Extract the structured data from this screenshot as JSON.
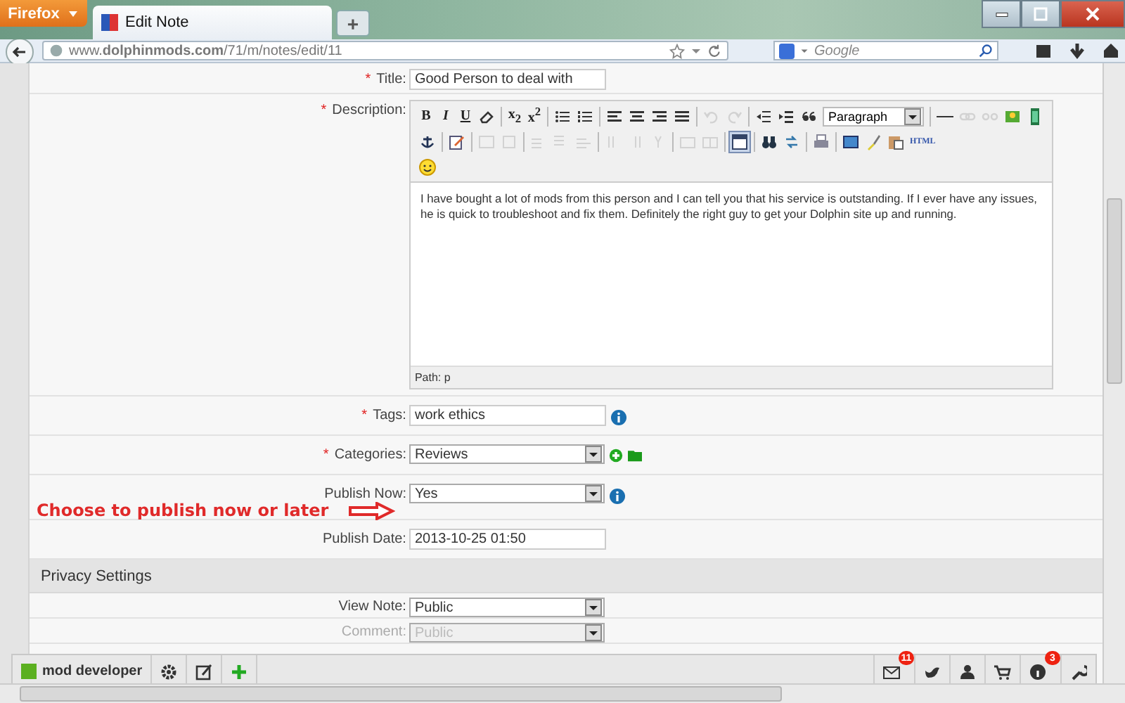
{
  "browser": {
    "menu_button": "Firefox",
    "tabs": [
      {
        "title": "Edit Note",
        "selected": true
      }
    ],
    "new_tab": "+",
    "url": "www.**dolphinmods.com**/71/m/notes/edit/11",
    "search": {
      "placeholder": "Google"
    }
  },
  "form": {
    "title": {
      "label": "Title:",
      "marker": "*",
      "value": "Good Person to deal with"
    },
    "description": {
      "label": "Description:",
      "marker": "*",
      "toolbar_rows": [
        [
          {
            "kind": "text",
            "label": "B"
          },
          {
            "kind": "text",
            "label": "I"
          },
          {
            "kind": "text",
            "label": "U"
          },
          {
            "kind": "icon",
            "disabled": false
          },
          {
            "kind": "sep"
          },
          {
            "kind": "text",
            "label": "x$_{2}$"
          },
          {
            "kind": "text",
            "label": "x$^{2}$"
          },
          {
            "kind": "sep"
          },
          {
            "kind": "icon",
            "disabled": false
          },
          {
            "kind": "icon",
            "disabled": false
          },
          {
            "kind": "sep"
          },
          {
            "kind": "icon",
            "disabled": false
          },
          {
            "kind": "icon",
            "disabled": false
          },
          {
            "kind": "icon",
            "disabled": false
          },
          {
            "kind": "icon",
            "disabled": false
          },
          {
            "kind": "sep"
          },
          {
            "kind": "icon",
            "disabled": true
          },
          {
            "kind": "icon",
            "disabled": true
          },
          {
            "kind": "sep"
          },
          {
            "kind": "icon",
            "disabled": false
          },
          {
            "kind": "icon",
            "disabled": false
          },
          {
            "kind": "icon",
            "disabled": false
          },
          {
            "kind": "select",
            "label": "Paragraph"
          },
          {
            "kind": "sep"
          },
          {
            "kind": "icon",
            "disabled": false
          },
          {
            "kind": "icon",
            "disabled": true
          },
          {
            "kind": "icon",
            "disabled": true
          },
          {
            "kind": "icon",
            "disabled": false
          },
          {
            "kind": "icon",
            "disabled": false
          }
        ],
        [
          {
            "kind": "icon",
            "disabled": false
          },
          {
            "kind": "sep"
          },
          {
            "kind": "icon",
            "disabled": false
          },
          {
            "kind": "sep"
          },
          {
            "kind": "icon",
            "disabled": true
          },
          {
            "kind": "icon",
            "disabled": true
          },
          {
            "kind": "sep"
          },
          {
            "kind": "icon",
            "disabled": true
          },
          {
            "kind": "icon",
            "disabled": true
          },
          {
            "kind": "icon",
            "disabled": true
          },
          {
            "kind": "sep"
          },
          {
            "kind": "icon",
            "disabled": true
          },
          {
            "kind": "icon",
            "disabled": true
          },
          {
            "kind": "icon",
            "disabled": true
          },
          {
            "kind": "sep"
          },
          {
            "kind": "icon",
            "disabled": true
          },
          {
            "kind": "icon",
            "disabled": true
          },
          {
            "kind": "sep"
          },
          {
            "kind": "icon",
            "disabled": false,
            "selected": true
          },
          {
            "kind": "sep"
          },
          {
            "kind": "icon",
            "disabled": false
          },
          {
            "kind": "icon",
            "disabled": false
          },
          {
            "kind": "sep"
          },
          {
            "kind": "icon",
            "disabled": false
          },
          {
            "kind": "sep"
          },
          {
            "kind": "icon",
            "disabled": false
          },
          {
            "kind": "icon",
            "disabled": false
          },
          {
            "kind": "icon",
            "disabled": false
          },
          {
            "kind": "text",
            "label": "HTML"
          }
        ],
        [
          {
            "kind": "icon",
            "disabled": false
          }
        ]
      ],
      "text": "I have bought a lot of mods from this person and I can tell you that his service is outstanding. If I ever have any issues, he is quick to troubleshoot and fix them. Definitely the right guy to get your Dolphin site up and running.",
      "path": "Path: p"
    },
    "fields": [
      {
        "kind": "input",
        "label": "Tags:",
        "marker": "*",
        "value": "work ethics",
        "info": true
      },
      {
        "kind": "select",
        "label": "Categories:",
        "marker": "*",
        "value": "Reviews",
        "add": true
      },
      {
        "kind": "select",
        "label": "Publish Now:",
        "value": "Yes",
        "info": true
      },
      {
        "kind": "input",
        "label": "Publish Date:",
        "value": "2013-10-25 01:50"
      }
    ],
    "section": "Privacy Settings",
    "privacy": [
      {
        "label": "View Note:",
        "value": "Public",
        "disabled": false
      },
      {
        "label": "Comment:",
        "value": "Public",
        "disabled": true
      }
    ]
  },
  "annotation": "Choose to publish now or later",
  "bottom_bar": {
    "user": "mod developer",
    "badges": [
      {
        "count": "11"
      },
      {
        "count": "3"
      }
    ]
  }
}
